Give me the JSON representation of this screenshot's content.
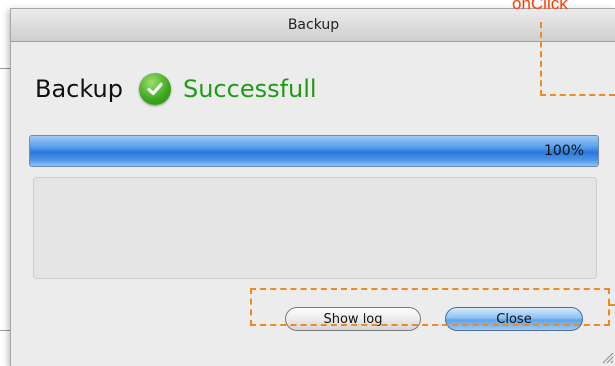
{
  "window": {
    "title": "Backup"
  },
  "status": {
    "prefix": "Backup",
    "message": "Successfull",
    "icon": "check-circle-icon",
    "color": "#1f9a16"
  },
  "progress": {
    "value": 100,
    "label": "100%"
  },
  "buttons": {
    "show_log": "Show log",
    "close": "Close"
  },
  "annotation": {
    "label": "onClick",
    "color": "#ef8a1f"
  }
}
